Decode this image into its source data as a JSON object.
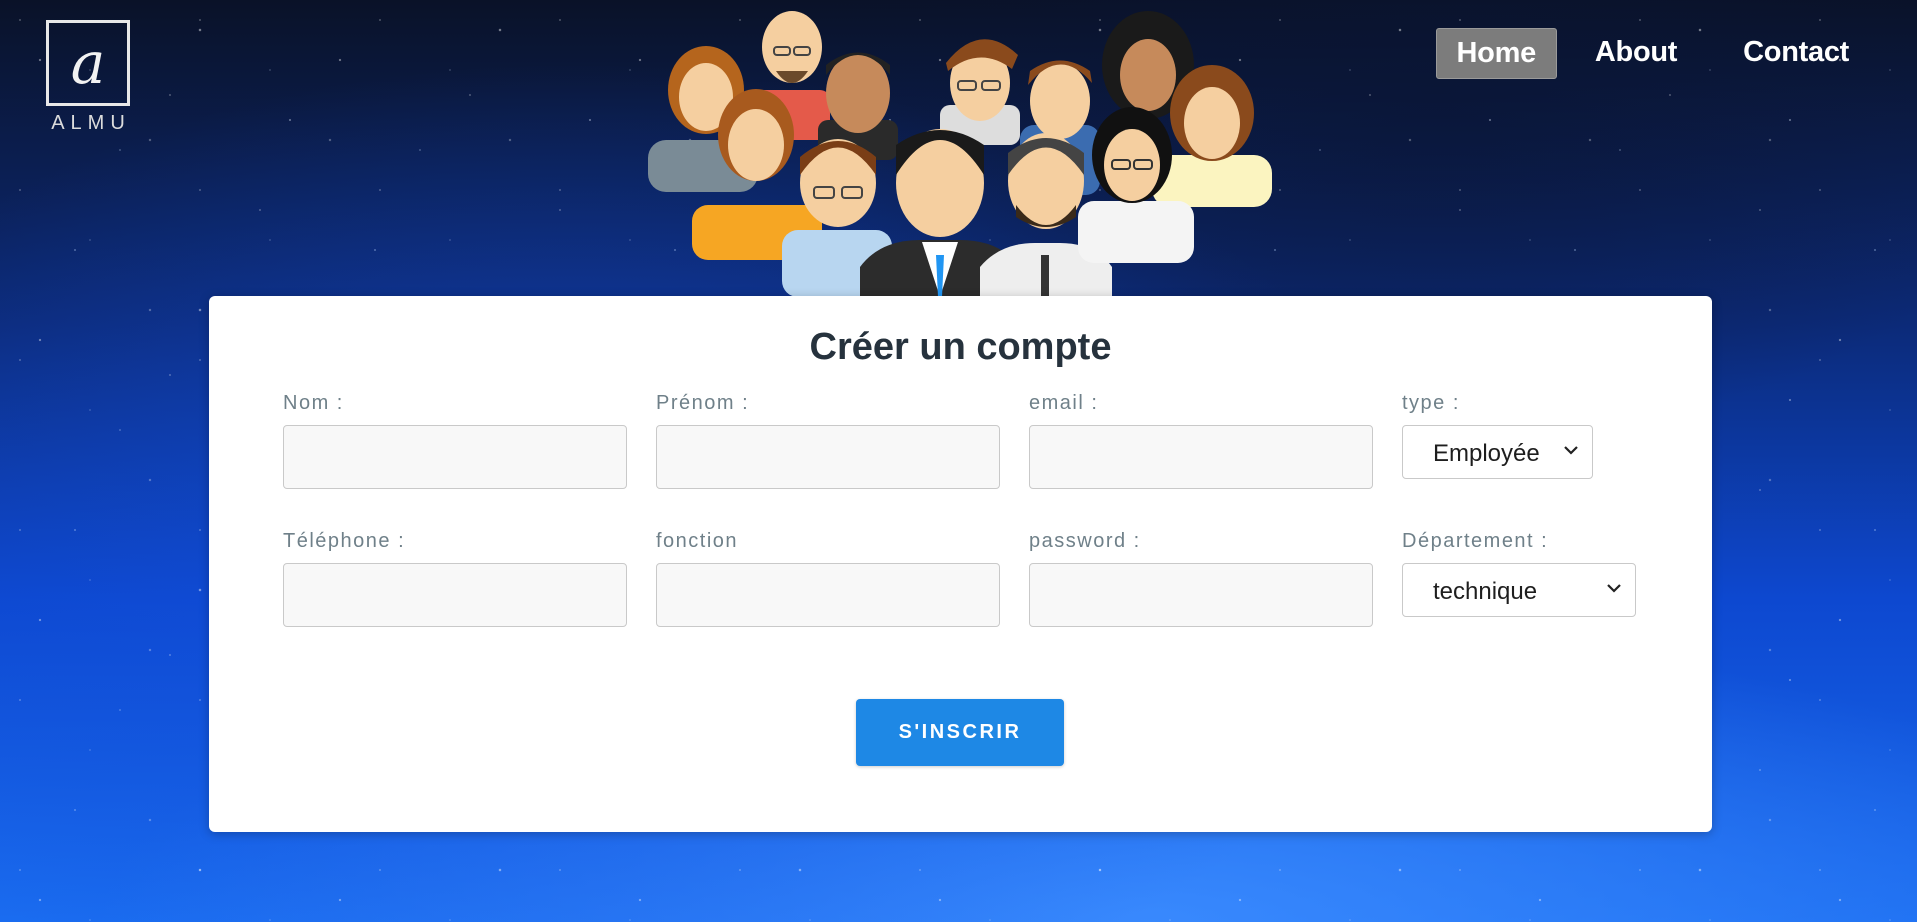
{
  "brand": {
    "logo_letter": "a",
    "logo_text": "ALMU"
  },
  "nav": {
    "items": [
      {
        "label": "Home",
        "active": true
      },
      {
        "label": "About",
        "active": false
      },
      {
        "label": "Contact",
        "active": false
      }
    ]
  },
  "form": {
    "title": "Créer un compte",
    "fields": {
      "nom": {
        "label": "Nom :",
        "value": ""
      },
      "prenom": {
        "label": "Prénom :",
        "value": ""
      },
      "email": {
        "label": "email :",
        "value": ""
      },
      "type": {
        "label": "type :",
        "selected": "Employée"
      },
      "telephone": {
        "label": "Téléphone :",
        "value": ""
      },
      "fonction": {
        "label": "fonction",
        "value": ""
      },
      "password": {
        "label": "password :",
        "value": ""
      },
      "departement": {
        "label": "Département :",
        "selected": "technique"
      }
    },
    "submit_label": "S'INSCRIR"
  },
  "icons": [
    "logo-icon",
    "team-illustration",
    "chevron-down-icon"
  ],
  "colors": {
    "accent": "#1e88e5",
    "nav_active_bg": "#7c7c7c",
    "title": "#26323d",
    "label": "#6f8089"
  }
}
